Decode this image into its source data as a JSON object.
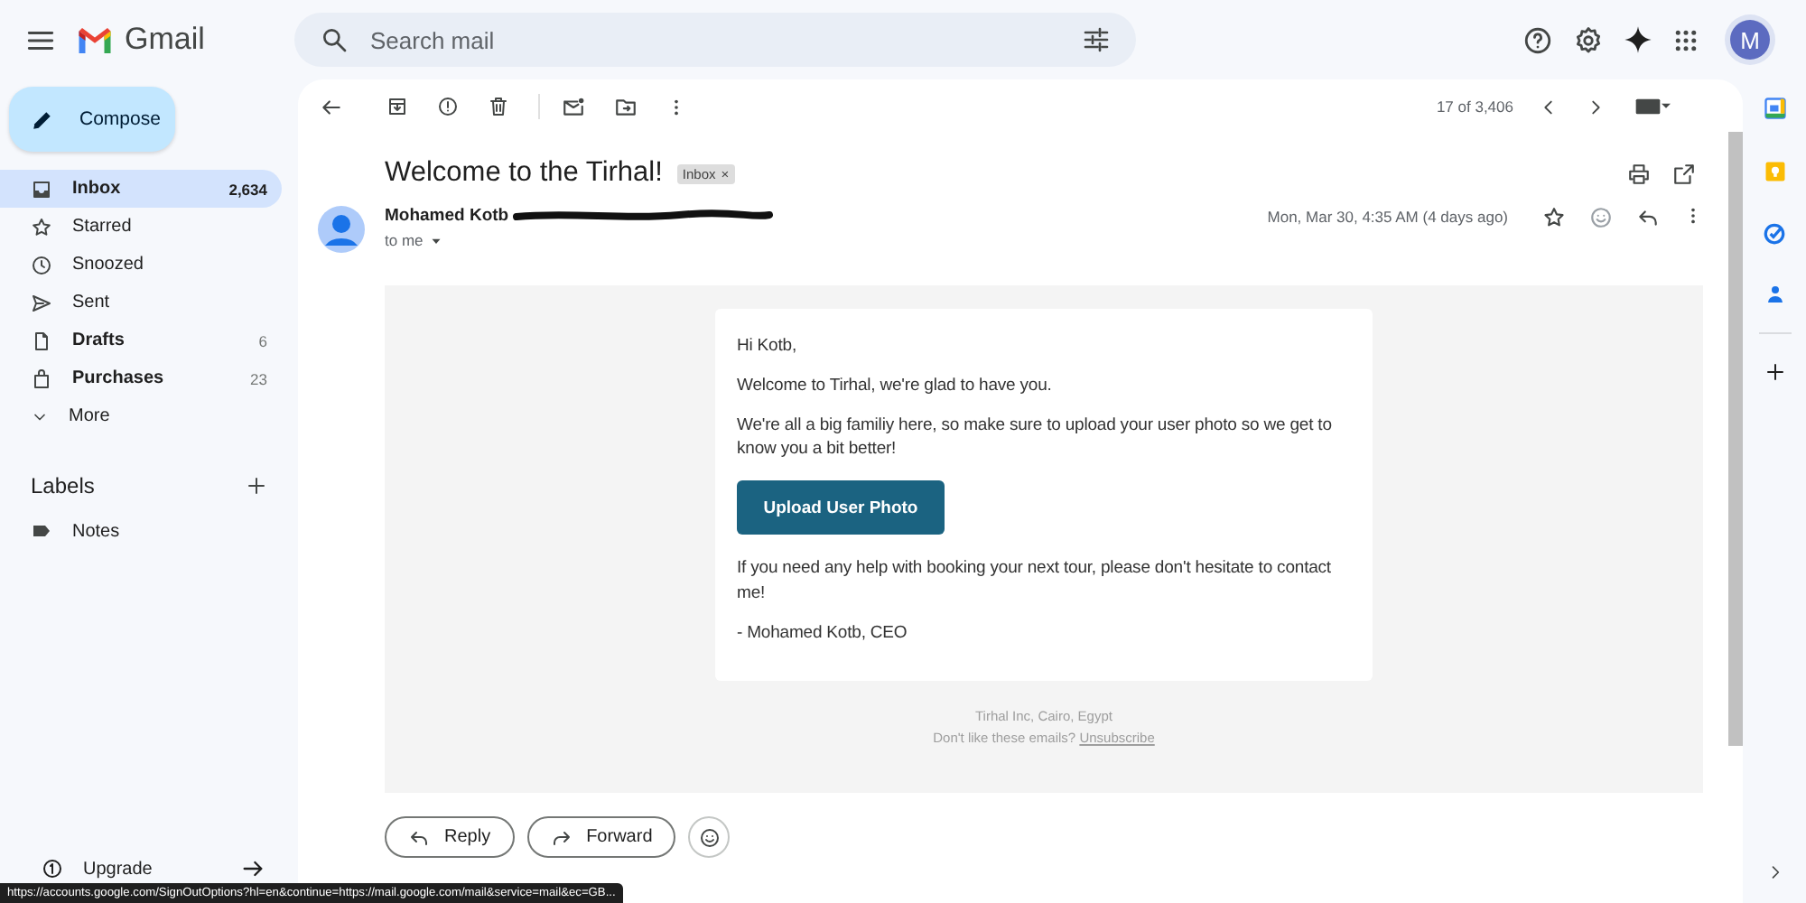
{
  "header": {
    "app_name": "Gmail",
    "search": {
      "placeholder": "Search mail"
    },
    "avatar": "M"
  },
  "sidebar": {
    "compose": "Compose",
    "items": [
      {
        "label": "Inbox",
        "count": "2,634",
        "unread": true,
        "selected": true
      },
      {
        "label": "Starred",
        "unread": false,
        "selected": false
      },
      {
        "label": "Snoozed",
        "unread": false,
        "selected": false
      },
      {
        "label": "Sent",
        "unread": false,
        "selected": false
      },
      {
        "label": "Drafts",
        "count": "6",
        "unread": true,
        "selected": false
      },
      {
        "label": "Purchases",
        "count": "23",
        "unread": true,
        "selected": false
      },
      {
        "label": "More",
        "unread": false,
        "selected": false
      }
    ],
    "labels": {
      "title": "Labels",
      "items": [
        {
          "label": "Notes"
        }
      ]
    },
    "upgrade": "Upgrade"
  },
  "toolbar": {
    "position": "17 of 3,406"
  },
  "message": {
    "subject": "Welcome to the Tirhal!",
    "tag": "Inbox",
    "tag_remove": "×",
    "sender": "Mohamed Kotb",
    "recipient": "to me",
    "date": "Mon, Mar 30, 4:35 AM (4 days ago)",
    "blocks": [
      {
        "kind": "text",
        "text": "Hi Kotb,"
      },
      {
        "kind": "text",
        "text": "Welcome to Tirhal, we're glad to have you."
      },
      {
        "kind": "text",
        "text": "We're all a big familiy here, so make sure to upload your user photo so we get to know you a bit better!"
      },
      {
        "kind": "button",
        "text": "Upload User Photo"
      },
      {
        "kind": "text",
        "text": "If you need any help with booking your next tour, please don't hesitate to contact me!"
      },
      {
        "kind": "text",
        "text": "- Mohamed Kotb, CEO"
      }
    ],
    "footer": {
      "address": "Tirhal Inc, Cairo, Egypt",
      "prompt": "Don't like these emails?",
      "link": "Unsubscribe"
    }
  },
  "actions": [
    {
      "kind": "reply",
      "label": "Reply"
    },
    {
      "kind": "forward",
      "label": "Forward"
    }
  ],
  "status_bar": {
    "url": "https://accounts.google.com/SignOutOptions?hl=en&continue=https://mail.google.com/mail&service=mail&ec=GB..."
  }
}
